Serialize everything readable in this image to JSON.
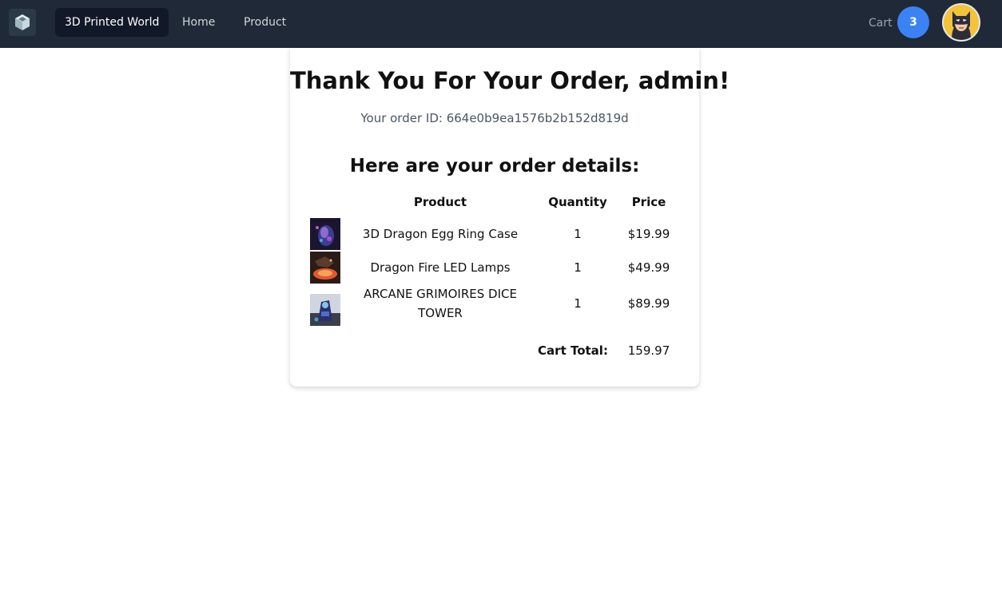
{
  "navbar": {
    "logo_icon": "cube-logo-icon",
    "brand": "3D Printed World",
    "links": [
      "Home",
      "Product"
    ],
    "cart_label": "Cart",
    "cart_count": "3",
    "avatar_icon": "batman-avatar-icon"
  },
  "order": {
    "title": "Thank You For Your Order, admin!",
    "order_id_line": "Your order ID: 664e0b9ea1576b2b152d819d",
    "details_heading": "Here are your order details:",
    "columns": {
      "product": "Product",
      "quantity": "Quantity",
      "price": "Price"
    },
    "items": [
      {
        "name": "3D Dragon Egg Ring Case",
        "quantity": "1",
        "price": "$19.99",
        "image_icon": "dragon-egg-thumbnail"
      },
      {
        "name": "Dragon Fire LED Lamps",
        "quantity": "1",
        "price": "$49.99",
        "image_icon": "dragon-lamp-thumbnail"
      },
      {
        "name": "ARCANE GRIMOIRES DICE TOWER",
        "quantity": "1",
        "price": "$89.99",
        "image_icon": "dice-tower-thumbnail"
      }
    ],
    "total_label": "Cart Total:",
    "total_value": "159.97"
  },
  "colors": {
    "navbar_bg": "#1f2937",
    "brand_bg": "#111827",
    "cart_badge": "#3b82f6",
    "avatar_bg": "#f3c33a"
  }
}
